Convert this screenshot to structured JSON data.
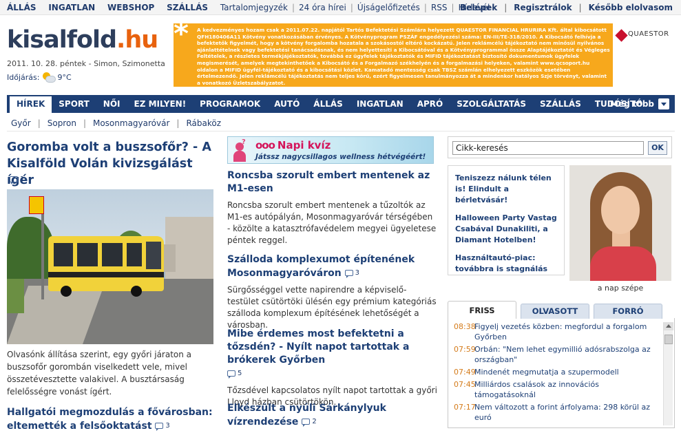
{
  "topbar": {
    "bold_links": [
      "ÁLLÁS",
      "INGATLAN",
      "WEBSHOP",
      "SZÁLLÁS"
    ],
    "links": [
      "Tartalomjegyzék",
      "24 óra hírei",
      "Újságelőfizetés",
      "RSS",
      "Hírlevél"
    ],
    "right": [
      "Belépek",
      "Regisztrálok",
      "Később elolvasom"
    ]
  },
  "logo": {
    "name": "kisalfold",
    "dot": ".",
    "tld": "hu"
  },
  "date_line": "2011. 10. 28. péntek - Simon, Szimonetta",
  "weather": {
    "label": "Időjárás:",
    "icon": "partly-cloudy-icon",
    "temp": "9°C"
  },
  "ad": {
    "text": "A kedvezményes hozam csak a 2011.07.22. napjától Tartós Befektetési Számlára helyezett QUAESTOR FINANCIAL HRURIRA Kft. által kibocsátott QFH180406A11 Kötvény vonatkozásában érvényes. A Kötvényprogram PSZÁF engedélyezési száma: EN-III/TE-318/2010. A Kibocsátó felhívja a befektetők figyelmét, hogy a kötvény forgalomba hozatala a szokásostól eltérő kockázatú. Jelen reklámcélú tájékoztató nem minősül nyilvános ajánlattételnek vagy befektetési tanácsadásnak, és nem helyettesíti a Kibocsátóval és a Kötvényprogrammal össze Alaptájékoztatót és Végleges Feltételek, a részletes termékjájékoztatók, továbbá ez ügyfelek tájékoztatók és MIFID tájékoztatást biztosító dokumentumok ügyfelek megismerését, amelyek megtekinthetőek a Kibocsátó és a Forgalmazó székhelyén és a forgalmazási helyeken, valamint www.qcsoport.hu oldalon a MIFID ügyfél-tájékoztató és a kibocsátási közlet. Kamatadó mentesség csak TBSZ számlán elhelyezett eszközök esetében értelmezendő. Jelen reklámcélú tájékoztatás nem teljes körű, ezért figyelmesen tanulmányozza át a mindenkor hatályos Szje törvényt, valamint a vonatkozó Üzletszabályzatot.",
    "brand": "QUAESTOR"
  },
  "nav": {
    "items": [
      "HÍREK",
      "SPORT",
      "NŐI",
      "EZ MILYEN!",
      "PROGRAMOK",
      "AUTÓ",
      "ÁLLÁS",
      "INGATLAN",
      "APRÓ",
      "SZOLGÁLTATÁS",
      "SZÁLLÁS",
      "TUDÓSÍTÓ"
    ],
    "more": "Még több"
  },
  "subnav": [
    "Győr",
    "Sopron",
    "Mosonmagyaróvár",
    "Rábaköz"
  ],
  "lead": {
    "title": "Goromba volt a buszsofőr? - A Kisalföld Volán kivizsgálást ígér",
    "comments": "1",
    "desc": "Olvasónk állítása szerint, egy győri járaton a buszsofőr gorombán viselkedett vele, mivel összetévesztette valakivel. A busztársaság felelősségre vonást ígért."
  },
  "story2": {
    "title": "Hallgatói megmozdulás a fővárosban: eltemették a felsőoktatást",
    "comments": "3"
  },
  "quiz": {
    "title": "Napi kvíz",
    "circles": "ooo",
    "sub": "Játssz nagycsillagos wellness hétvégéért!"
  },
  "mid": [
    {
      "title": "Roncsba szorult embert mentenek az M1-esen",
      "comments": "",
      "text": "Roncsba szorult embert mentenek a tűzoltók az M1-es autópályán, Mosonmagyaróvár térségében - közölte a katasztrófavédelem megyei ügyeletese péntek reggel."
    },
    {
      "title": "Szálloda komplexumot építenének Mosonmagyaróváron",
      "comments": "3",
      "text": "Sürgősséggel vette napirendre a képviselő-testület csütörtöki ülésén egy prémium kategóriás szálloda komplexum építésének lehetőségét a városban."
    },
    {
      "title": "Mibe érdemes most befektetni a tőzsdén? - Nyílt napot tartottak a brókerek Győrben",
      "comments": "5",
      "text": "Tőzsdével kapcsolatos nyílt napot tartottak a győri Lloyd házban csütörtökön."
    },
    {
      "title": "Elkészült a nyúli Sárkánylyuk vízrendezése",
      "comments": "2",
      "text": ""
    }
  ],
  "search": {
    "value": "Cikk-keresés",
    "button": "OK"
  },
  "promo": [
    "Teniszezz nálunk télen is! Elindult a bérletvásár!",
    "Halloween Party Vastag Csabával Dunakiliti, a Diamant Hotelben!",
    "Használtautó-piac: továbbra is stagnálás"
  ],
  "beauty": {
    "caption": "a nap szépe"
  },
  "tabs": [
    "FRISS",
    "OLVASOTT",
    "FORRÓ"
  ],
  "fresh": [
    {
      "time": "08:38",
      "text": "Figyelj vezetés közben: megfordul a forgalom Győrben"
    },
    {
      "time": "07:59",
      "text": "Orbán: \"Nem lehet egymillió adósrabszolga az országban\""
    },
    {
      "time": "07:49",
      "text": "Mindenét megmutatja a szupermodell"
    },
    {
      "time": "07:45",
      "text": "Milliárdos csalások az innovációs támogatásoknál"
    },
    {
      "time": "07:17",
      "text": "Nem változott a forint árfolyama: 298 körül az euró"
    }
  ]
}
